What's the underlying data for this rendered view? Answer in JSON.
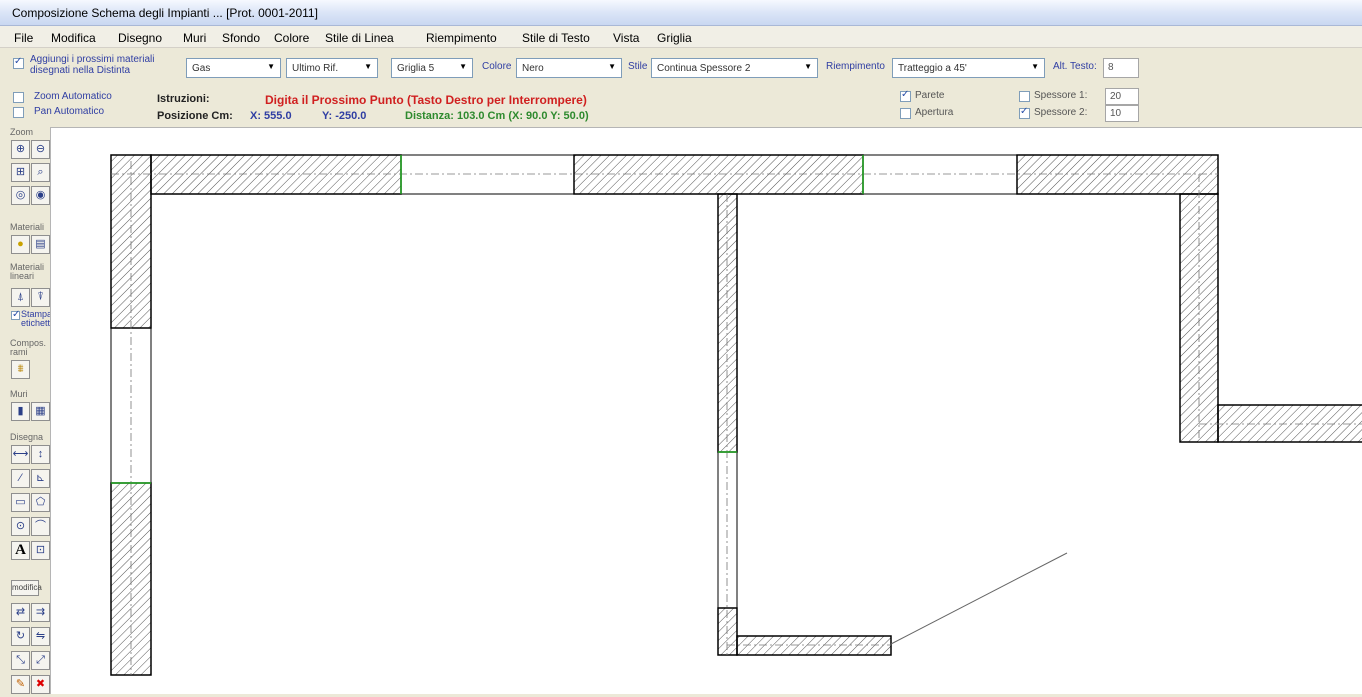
{
  "window": {
    "title": "Composizione Schema degli Impianti ...  [Prot. 0001-2011]"
  },
  "menu": [
    "File",
    "Modifica",
    "Disegno",
    "Muri",
    "Sfondo",
    "Colore",
    "Stile di Linea",
    "Riempimento",
    "Stile di Testo",
    "Vista",
    "Griglia"
  ],
  "toolbar": {
    "add_materials_label": "Aggiungi i prossimi materiali disegnati nella Distinta",
    "material_value": "Gas",
    "last_ref_value": "Ultimo Rif.",
    "grid_value": "Griglia  5",
    "color_label": "Colore",
    "color_value": "Nero",
    "style_label": "Stile",
    "style_value": "Continua Spessore 2",
    "fill_label": "Riempimento",
    "fill_value": "Tratteggio a 45'",
    "text_height_label": "Alt. Testo:",
    "text_height_value": "8"
  },
  "options": {
    "zoom_auto_label": "Zoom Automatico",
    "pan_auto_label": "Pan Automatico",
    "wall_label": "Parete",
    "wall_checked": true,
    "opening_label": "Apertura",
    "opening_checked": false,
    "thickness1_label": "Spessore 1:",
    "thickness1_value": "20",
    "thickness1_checked": false,
    "thickness2_label": "Spessore 2:",
    "thickness2_value": "10",
    "thickness2_checked": true
  },
  "status": {
    "instructions_label": "Istruzioni:",
    "instructions_text": "Digita il Prossimo Punto (Tasto Destro per Interrompere)",
    "position_label": "Posizione  Cm:",
    "x_text": "X: 555.0",
    "y_text": "Y: -250.0",
    "distance_text": "Distanza: 103.0 Cm (X: 90.0 Y: 50.0)"
  },
  "sidebar": {
    "zoom_label": "Zoom",
    "materials_label": "Materiali",
    "linear_materials_label": "Materiali lineari",
    "print_label_label": "Stampa etichetta",
    "print_label_checked": true,
    "branches_label": "Compos. rami",
    "walls_label": "Muri",
    "draw_label": "Disegna",
    "modify_label": "modifica"
  },
  "colors": {
    "accent_blue": "#2f3ea3",
    "instruction_red": "#d02020",
    "distance_green": "#2e8a2e",
    "wall_border": "#000000",
    "hatch": "#555555",
    "junction_green": "#22aa22"
  }
}
